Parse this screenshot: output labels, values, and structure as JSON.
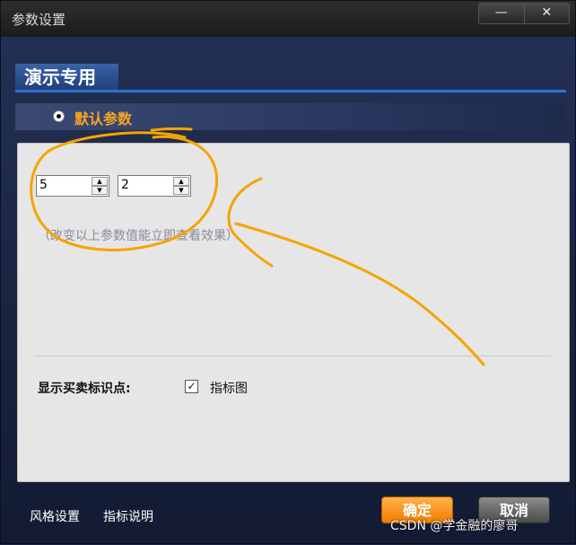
{
  "window": {
    "title": "参数设置",
    "minimize_label": "—",
    "close_label": "✕"
  },
  "section": {
    "title": "演示专用"
  },
  "radio_option": {
    "label": "默认参数",
    "selected": true
  },
  "params": {
    "param1": "5",
    "param2": "2",
    "hint": "（改变以上参数值能立即查看效果）"
  },
  "marks": {
    "label": "显示买卖标识点:",
    "checkbox_label": "指标图",
    "checked": true,
    "check_glyph": "✓"
  },
  "footer": {
    "style_settings": "风格设置",
    "indicator_help": "指标说明",
    "ok": "确定",
    "cancel": "取消"
  },
  "watermark": "CSDN @学金融的廖哥",
  "colors": {
    "accent_orange": "#f5a623",
    "annotation": "#f5a400"
  }
}
